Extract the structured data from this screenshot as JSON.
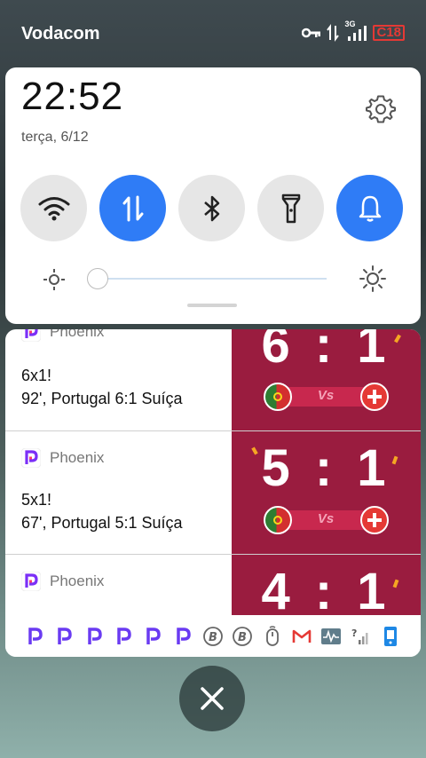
{
  "status_bar": {
    "carrier": "Vodacom",
    "network": "3G",
    "battery_label": "C18"
  },
  "quick_settings": {
    "time": "22:52",
    "date": "terça, 6/12",
    "tiles": [
      {
        "name": "wifi-icon",
        "active": false
      },
      {
        "name": "mobile-data-icon",
        "active": true
      },
      {
        "name": "bluetooth-icon",
        "active": false
      },
      {
        "name": "flashlight-icon",
        "active": false
      },
      {
        "name": "notification-bell-icon",
        "active": true
      }
    ],
    "brightness_level": 0.0,
    "colors": {
      "accent": "#2f7cf6",
      "tile_inactive": "#e6e6e6"
    }
  },
  "notifications": [
    {
      "app": "Phoenix",
      "title": "6x1!",
      "body": "92', Portugal 6:1 Suíça",
      "score_left": "6",
      "score_right": "1",
      "vs": "Vs"
    },
    {
      "app": "Phoenix",
      "title": "5x1!",
      "body": "67', Portugal 5:1 Suíça",
      "score_left": "5",
      "score_right": "1",
      "vs": "Vs"
    },
    {
      "app": "Phoenix",
      "title": "",
      "body": "",
      "score_left": "4",
      "score_right": "1",
      "vs": ""
    }
  ],
  "notification_icons": [
    "phoenix-icon",
    "phoenix-icon",
    "phoenix-icon",
    "phoenix-icon",
    "phoenix-icon",
    "phoenix-icon",
    "bitcoin-icon",
    "bitcoin-icon",
    "mouse-icon",
    "gmail-icon",
    "activity-icon",
    "signal-icon",
    "phone-icon"
  ],
  "close_button": {
    "icon": "close-icon"
  }
}
